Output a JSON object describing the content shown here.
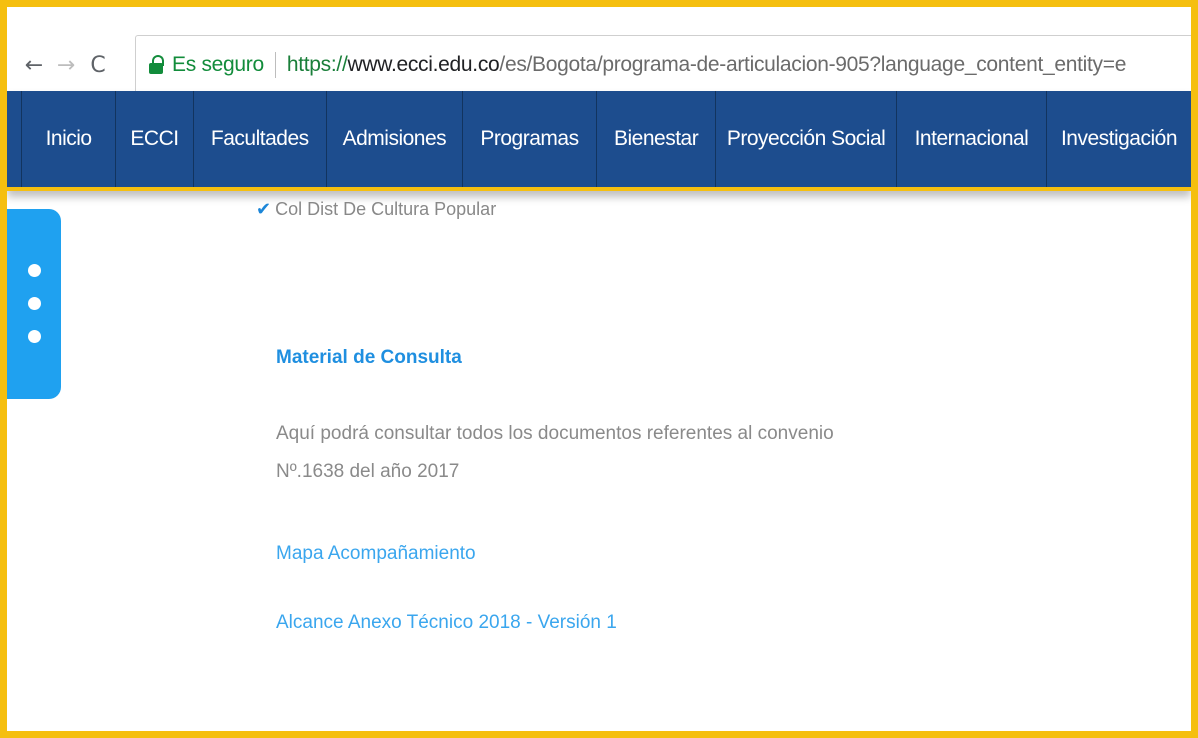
{
  "browser": {
    "back_icon": "←",
    "forward_icon": "→",
    "reload_icon": "C",
    "secure_label": "Es seguro",
    "url_scheme": "https://",
    "url_host": "www.ecci.edu.co",
    "url_path": "/es/Bogota/programa-de-articulacion-905?language_content_entity=e"
  },
  "nav": {
    "items": [
      {
        "label": "Inicio"
      },
      {
        "label": "ECCI"
      },
      {
        "label": "Facultades"
      },
      {
        "label": "Admisiones"
      },
      {
        "label": "Programas"
      },
      {
        "label": "Bienestar"
      },
      {
        "label": "Proyección Social"
      },
      {
        "label": "Internacional"
      },
      {
        "label": "Investigación"
      }
    ]
  },
  "content": {
    "check_mark": "✔",
    "school_item": "Col Dist De Cultura Popular",
    "section_title": "Material de Consulta",
    "description": "Aquí podrá consultar todos los documentos referentes al convenio Nº.1638 del año 2017",
    "links": [
      {
        "label": "Mapa Acompañamiento"
      },
      {
        "label": "Alcance Anexo Técnico 2018 - Versión 1"
      }
    ]
  },
  "colors": {
    "frame": "#f5bf0f",
    "nav_bg": "#1d4d8e",
    "secure_green": "#128c3b",
    "side_tab": "#1fa1f0",
    "link_blue": "#3aa6ee"
  }
}
